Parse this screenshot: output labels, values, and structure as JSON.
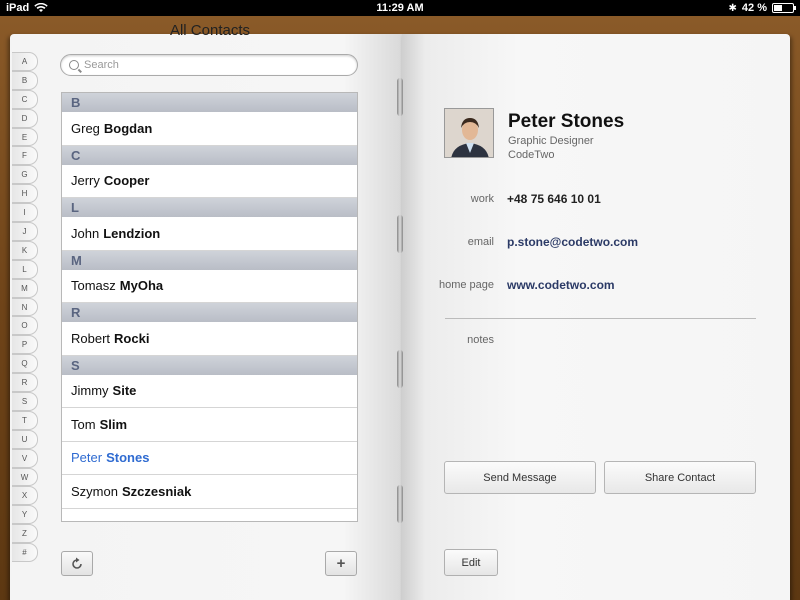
{
  "status_bar": {
    "device": "iPad",
    "time": "11:29 AM",
    "battery": "42 %",
    "battery_level": 0.42
  },
  "list": {
    "title": "All Contacts",
    "search_placeholder": "Search",
    "index_letters": [
      "A",
      "B",
      "C",
      "D",
      "E",
      "F",
      "G",
      "H",
      "I",
      "J",
      "K",
      "L",
      "M",
      "N",
      "O",
      "P",
      "Q",
      "R",
      "S",
      "T",
      "U",
      "V",
      "W",
      "X",
      "Y",
      "Z",
      "#"
    ],
    "sections": [
      {
        "letter": "B",
        "contacts": [
          {
            "first": "Greg",
            "last": "Bogdan"
          }
        ]
      },
      {
        "letter": "C",
        "contacts": [
          {
            "first": "Jerry",
            "last": "Cooper"
          }
        ]
      },
      {
        "letter": "L",
        "contacts": [
          {
            "first": "John",
            "last": "Lendzion"
          }
        ]
      },
      {
        "letter": "M",
        "contacts": [
          {
            "first": "Tomasz",
            "last": "MyOha"
          }
        ]
      },
      {
        "letter": "R",
        "contacts": [
          {
            "first": "Robert",
            "last": "Rocki"
          }
        ]
      },
      {
        "letter": "S",
        "contacts": [
          {
            "first": "Jimmy",
            "last": "Site"
          },
          {
            "first": "Tom",
            "last": "Slim"
          },
          {
            "first": "Peter",
            "last": "Stones",
            "selected": true
          },
          {
            "first": "Szymon",
            "last": "Szczesniak"
          }
        ]
      }
    ],
    "refresh_icon": "refresh-icon",
    "add_label": "+"
  },
  "detail": {
    "name": "Peter Stones",
    "job_title": "Graphic Designer",
    "company": "CodeTwo",
    "fields": {
      "work_label": "work",
      "work_value": "+48 75 646 10 01",
      "email_label": "email",
      "email_value": "p.stone@codetwo.com",
      "home_page_label": "home page",
      "home_page_value": "www.codetwo.com",
      "notes_label": "notes"
    },
    "send_message_label": "Send Message",
    "share_contact_label": "Share Contact",
    "edit_label": "Edit"
  },
  "colors": {
    "selected": "#2f6bd1",
    "section_header_text": "#5a6580",
    "leather": "#6f4419"
  }
}
